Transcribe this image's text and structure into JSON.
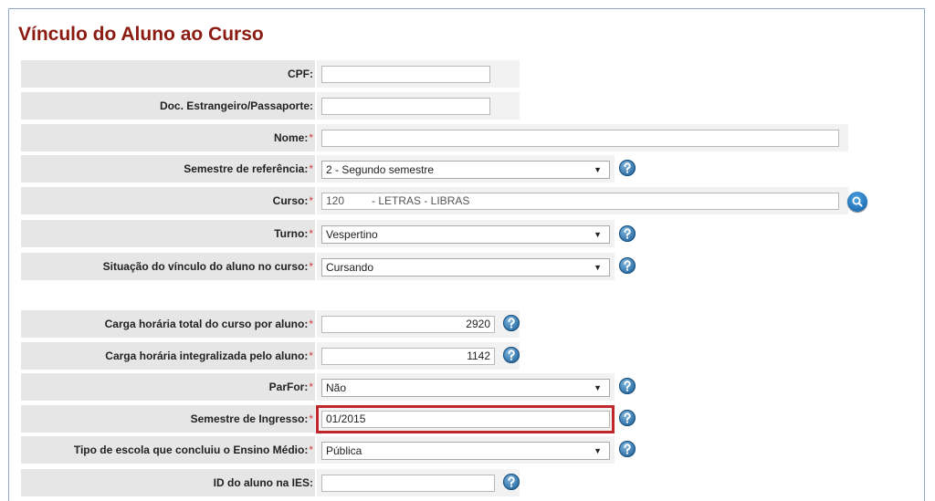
{
  "page": {
    "title": "Vínculo do Aluno ao Curso"
  },
  "form": {
    "cpf": {
      "label": "CPF:",
      "value": ""
    },
    "doc": {
      "label": "Doc. Estrangeiro/Passaporte:",
      "value": ""
    },
    "nome": {
      "label": "Nome:",
      "required": "*",
      "value": ""
    },
    "semestre_ref": {
      "label": "Semestre de referência:",
      "required": "*",
      "value": "2 - Segundo semestre"
    },
    "curso": {
      "label": "Curso:",
      "required": "*",
      "code": "120",
      "name": "- LETRAS - LIBRAS"
    },
    "turno": {
      "label": "Turno:",
      "required": "*",
      "value": "Vespertino"
    },
    "situacao": {
      "label": "Situação do vínculo do aluno no curso:",
      "required": "*",
      "value": "Cursando"
    },
    "carga_total": {
      "label": "Carga horária total do curso por aluno:",
      "required": "*",
      "value": "2920"
    },
    "carga_integralizada": {
      "label": "Carga horária integralizada pelo aluno:",
      "required": "*",
      "value": "1142"
    },
    "parfor": {
      "label": "ParFor:",
      "required": "*",
      "value": "Não"
    },
    "semestre_ingresso": {
      "label": "Semestre de Ingresso:",
      "required": "*",
      "value": "01/2015"
    },
    "tipo_escola": {
      "label": "Tipo de escola que concluiu o Ensino Médio:",
      "required": "*",
      "value": "Pública"
    },
    "id_aluno": {
      "label": "ID do aluno na IES:",
      "value": ""
    }
  },
  "icons": {
    "help": "help-question-icon",
    "search": "search-magnifier-icon",
    "dropdown": "dropdown-arrow-icon"
  },
  "colors": {
    "title": "#8b1a10",
    "required": "#d23b3b",
    "label_bg": "#e6e6e6",
    "highlight": "#c0272d",
    "help_icon": "#2c6fa5"
  }
}
